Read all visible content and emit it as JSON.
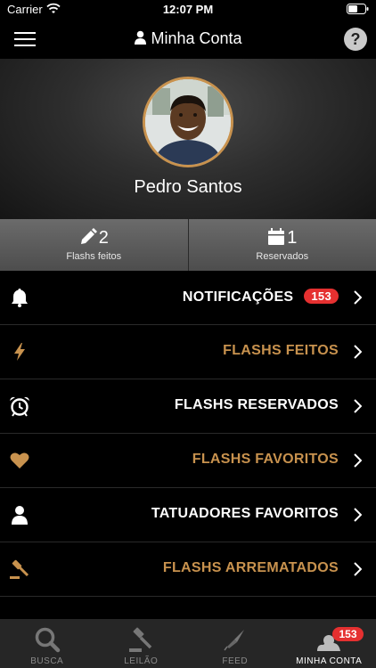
{
  "status_bar": {
    "carrier": "Carrier",
    "time": "12:07 PM"
  },
  "nav": {
    "title": "Minha Conta",
    "help_label": "?"
  },
  "profile": {
    "name": "Pedro Santos"
  },
  "stats": [
    {
      "value": "2",
      "label": "Flashs feitos",
      "icon": "pencil-icon"
    },
    {
      "value": "1",
      "label": "Reservados",
      "icon": "calendar-icon"
    }
  ],
  "menu": [
    {
      "label": "NOTIFICAÇÕES",
      "badge": "153",
      "icon": "bell-icon",
      "color": "#ffffff"
    },
    {
      "label": "FLASHS FEITOS",
      "icon": "lightning-icon",
      "color": "#c8924e"
    },
    {
      "label": "FLASHS RESERVADOS",
      "icon": "alarm-clock-icon",
      "color": "#ffffff"
    },
    {
      "label": "FLASHS FAVORITOS",
      "icon": "heart-icon",
      "color": "#c8924e"
    },
    {
      "label": "TATUADORES FAVORITOS",
      "icon": "person-icon",
      "color": "#ffffff"
    },
    {
      "label": "FLASHS ARREMATADOS",
      "icon": "gavel-icon",
      "color": "#c8924e"
    }
  ],
  "tabs": [
    {
      "label": "BUSCA",
      "icon": "search-icon",
      "active": false
    },
    {
      "label": "LEILÃO",
      "icon": "gavel-icon",
      "active": false
    },
    {
      "label": "FEED",
      "icon": "needle-icon",
      "active": false
    },
    {
      "label": "MINHA CONTA",
      "icon": "account-cloud-icon",
      "active": true,
      "badge": "153"
    }
  ],
  "colors": {
    "accent": "#c8924e",
    "badge": "#e53030",
    "background": "#000000",
    "tab_bar": "#262626"
  }
}
